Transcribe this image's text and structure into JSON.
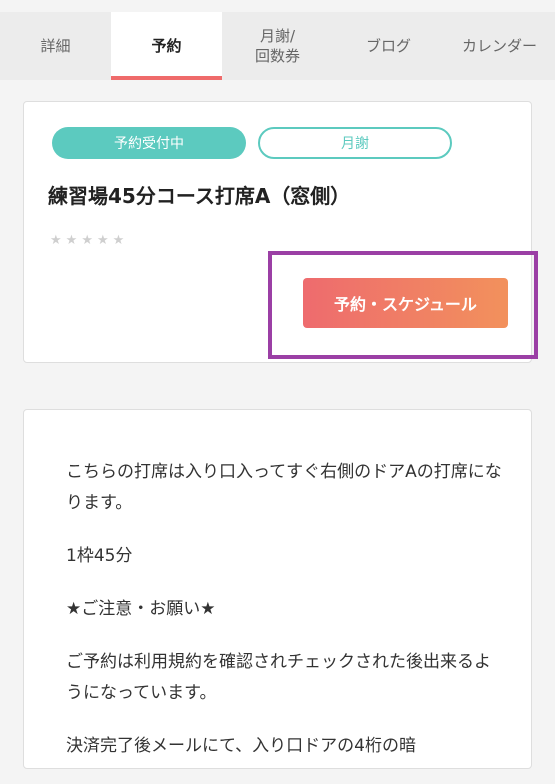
{
  "tabs": [
    {
      "label": "詳細",
      "active": false
    },
    {
      "label": "予約",
      "active": true
    },
    {
      "label": "月謝/\n回数券",
      "active": false
    },
    {
      "label": "ブログ",
      "active": false
    },
    {
      "label": "カレンダー",
      "active": false
    }
  ],
  "course": {
    "status_badge": "予約受付中",
    "plan_badge": "月謝",
    "title": "練習場45分コース打席A（窓側）",
    "rating_stars": 5,
    "rating_value": 0,
    "reserve_button": "予約・スケジュール"
  },
  "description": {
    "paragraphs": [
      "こちらの打席は入り口入ってすぐ右側のドアAの打席になります。",
      "1枠45分",
      "★ご注意・お願い★",
      "ご予約は利用規約を確認されチェックされた後出来るようになっています。",
      "決済完了後メールにて、入り口ドアの4桁の暗"
    ]
  },
  "colors": {
    "accent_teal": "#5ccabf",
    "active_tab_underline": "#ef6b6b",
    "button_gradient_start": "#ee6b6e",
    "button_gradient_end": "#f2915c",
    "highlight_border": "#9b3fa5"
  }
}
